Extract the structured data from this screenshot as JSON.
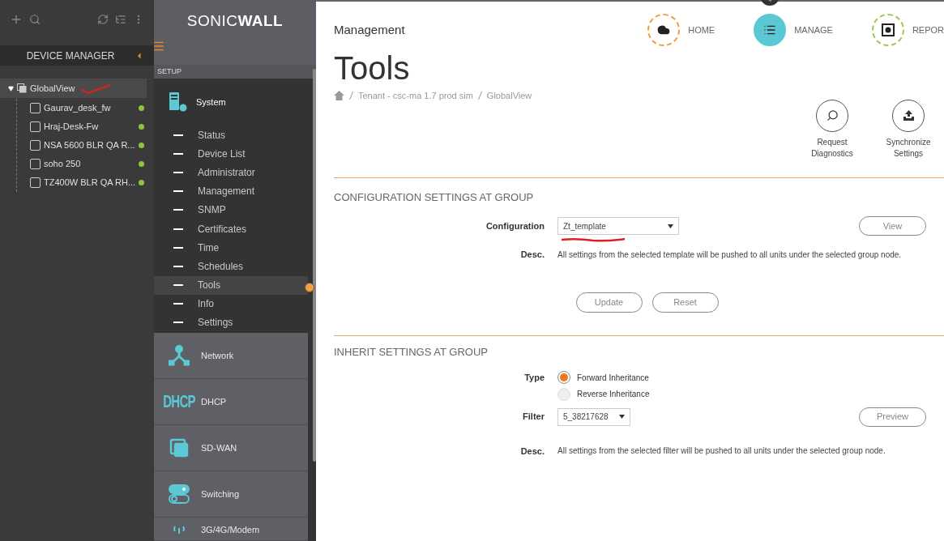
{
  "device_manager": {
    "title": "DEVICE MANAGER",
    "tree": [
      {
        "label": "GlobalView",
        "expanded": true,
        "selected": true,
        "children": [
          {
            "label": "Gaurav_desk_fw",
            "checked": false,
            "color": "#8cc63f"
          },
          {
            "label": "Hraj-Desk-Fw",
            "checked": false,
            "color": "#8cc63f"
          },
          {
            "label": "NSA 5600 BLR QA R...",
            "checked": false,
            "color": "#8cc63f"
          },
          {
            "label": "soho 250",
            "checked": false,
            "color": "#8cc63f"
          },
          {
            "label": "TZ400W BLR QA RH...",
            "checked": false,
            "color": "#8cc63f"
          }
        ]
      }
    ]
  },
  "nav": {
    "logo": "SONIC**WALL**",
    "section": "SETUP",
    "system": {
      "label": "System",
      "items": [
        {
          "label": "Status",
          "selected": false
        },
        {
          "label": "Device List",
          "selected": false
        },
        {
          "label": "Administrator",
          "selected": false
        },
        {
          "label": "Management",
          "selected": false
        },
        {
          "label": "SNMP",
          "selected": false
        },
        {
          "label": "Certificates",
          "selected": false
        },
        {
          "label": "Time",
          "selected": false
        },
        {
          "label": "Schedules",
          "selected": false
        },
        {
          "label": "Tools",
          "selected": true
        },
        {
          "label": "Info",
          "selected": false
        },
        {
          "label": "Settings",
          "selected": false
        }
      ]
    },
    "categories": [
      {
        "label": "Network",
        "kind": "network"
      },
      {
        "label": "DHCP",
        "kind": "dhcp",
        "icon_text": "DHCP"
      },
      {
        "label": "SD-WAN",
        "kind": "sdwan"
      },
      {
        "label": "Switching",
        "kind": "switching"
      },
      {
        "label": "3G/4G/Modem",
        "kind": "modem"
      }
    ]
  },
  "header": {
    "title": "Management",
    "tabs": [
      {
        "label": "HOME",
        "selected": false,
        "color": "#f0a040",
        "kind": "home"
      },
      {
        "label": "MANAGE",
        "selected": true,
        "color": "#5bc8d4",
        "kind": "manage"
      },
      {
        "label": "REPOR",
        "selected": false,
        "color": "#9cc850",
        "kind": "report"
      }
    ]
  },
  "page": {
    "title": "Tools",
    "breadcrumb": [
      "Tenant - csc-ma 1.7 prod sim",
      "GlobalView"
    ],
    "actions": [
      {
        "label": "Request Diagnostics",
        "kind": "diagnostics"
      },
      {
        "label": "Synchronize Settings",
        "kind": "sync"
      }
    ]
  },
  "config_section": {
    "heading": "CONFIGURATION SETTINGS AT GROUP",
    "configuration_label": "Configuration",
    "configuration_value": "Zt_template",
    "view_button": "View",
    "desc_label": "Desc.",
    "desc": "All settings from the selected template will be pushed to all units under the selected group node.",
    "buttons": [
      "Update",
      "Reset"
    ]
  },
  "inherit_section": {
    "heading": "INHERIT SETTINGS AT GROUP",
    "type_label": "Type",
    "options": [
      {
        "label": "Forward Inheritance",
        "selected": true
      },
      {
        "label": "Reverse Inheritance",
        "selected": false
      }
    ],
    "filter_label": "Filter",
    "filter_value": "5_38217628",
    "preview_button": "Preview",
    "desc_label": "Desc.",
    "desc": "All settings from the selected filter will be pushed to all units under the selected group node."
  }
}
